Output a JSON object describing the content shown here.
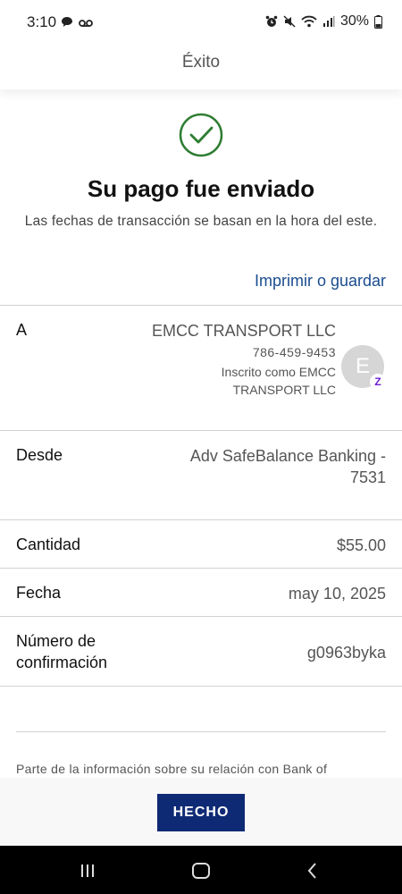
{
  "status_bar": {
    "time": "3:10",
    "battery": "30%",
    "icons": [
      "chat-bubble-icon",
      "voicemail-icon",
      "alarm-icon",
      "mute-icon",
      "wifi-icon",
      "signal-icon",
      "battery-icon"
    ]
  },
  "header": {
    "title": "Éxito"
  },
  "success": {
    "icon": "check-circle-icon",
    "title": "Su pago fue enviado",
    "subtitle": "Las fechas de transacción se basan en la hora del este.",
    "print_link": "Imprimir o guardar"
  },
  "details": {
    "to_label": "A",
    "payee_name": "EMCC TRANSPORT LLC",
    "payee_phone": "786-459-9453",
    "payee_enrolled": "Inscrito como EMCC TRANSPORT LLC",
    "avatar_letter": "E",
    "from_label": "Desde",
    "from_value": "Adv SafeBalance Banking - 7531",
    "amount_label": "Cantidad",
    "amount_value": "$55.00",
    "date_label": "Fecha",
    "date_value": "may 10, 2025",
    "confirmation_label": "Número de confirmación",
    "confirmation_value": "g0963byka"
  },
  "footer_note": "Parte de la información sobre su relación con Bank of",
  "actions": {
    "done_label": "HECHO"
  },
  "colors": {
    "accent": "#1a4d8f",
    "button": "#0f2a74",
    "success": "#2e7d32",
    "zelle": "#6d1ed4"
  }
}
